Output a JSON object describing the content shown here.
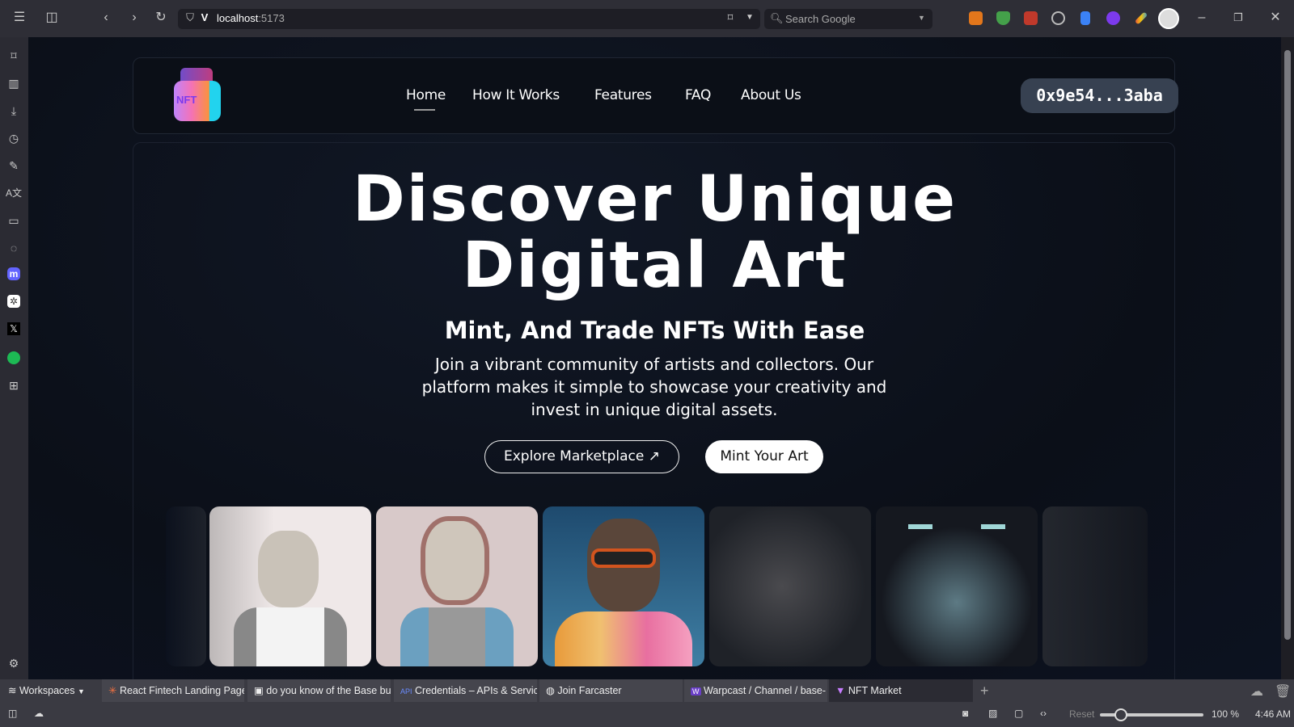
{
  "browser": {
    "url_host": "localhost",
    "url_port": ":5173",
    "search_placeholder": "Search Google",
    "tabs": [
      {
        "label": "React Fintech Landing Page",
        "icon": "asterisk-icon"
      },
      {
        "label": "do you know of the Base bu",
        "icon": "robot-icon"
      },
      {
        "label": "Credentials – APIs & Service",
        "icon": "api-icon"
      },
      {
        "label": "Join Farcaster",
        "icon": "globe-icon"
      },
      {
        "label": "Warpcast / Channel / base-",
        "icon": "warpcast-icon"
      },
      {
        "label": "NFT Market",
        "icon": "vite-icon"
      }
    ],
    "workspaces_label": "Workspaces",
    "status": {
      "reset_label": "Reset",
      "zoom": "100 %",
      "zoom_percent": 100,
      "time": "4:46 AM"
    }
  },
  "site": {
    "logo_text": "NFT",
    "nav": [
      "Home",
      "How It Works",
      "Features",
      "FAQ",
      "About Us"
    ],
    "wallet": "0x9e54...3aba",
    "hero": {
      "title_line1": "Discover Unique",
      "title_line2": "Digital Art",
      "subtitle": "Mint, And Trade NFTs With Ease",
      "paragraph": "Join a vibrant community of artists and collectors. Our platform makes it simple to showcase your creativity and invest in unique digital assets.",
      "explore_button": "Explore Marketplace",
      "mint_button": "Mint Your Art"
    }
  }
}
